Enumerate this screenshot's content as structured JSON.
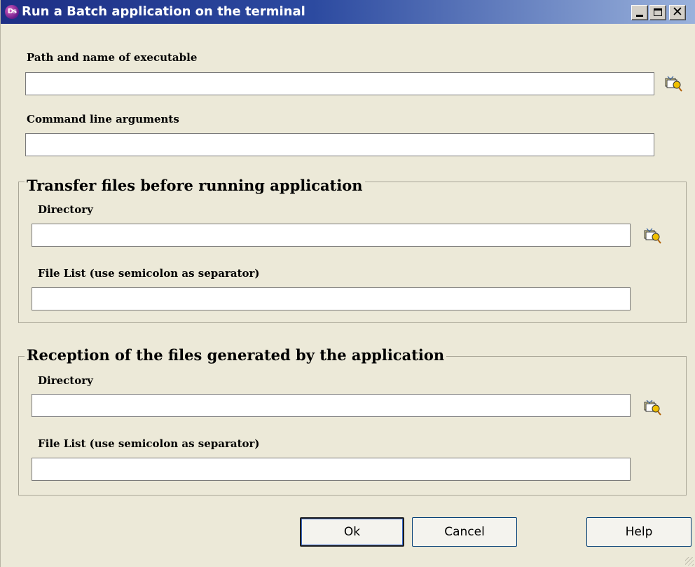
{
  "window": {
    "title": "Run a Batch application on the terminal",
    "app_icon_text": "Ds",
    "controls": {
      "minimize_icon": "minimize-icon",
      "maximize_icon": "maximize-icon",
      "close_symbol": "✕"
    }
  },
  "executable": {
    "label": "Path and name of executable",
    "value": "",
    "browse_icon": "browse-folder-icon"
  },
  "arguments": {
    "label": "Command line arguments",
    "value": ""
  },
  "transfer_group": {
    "legend": "Transfer files before running application",
    "directory_label": "Directory",
    "directory_value": "",
    "file_list_label": "File List (use semicolon as separator)",
    "file_list_value": ""
  },
  "reception_group": {
    "legend": "Reception of the files generated by the application",
    "directory_label": "Directory",
    "directory_value": "",
    "file_list_label": "File List (use semicolon as separator)",
    "file_list_value": ""
  },
  "buttons": {
    "ok": "Ok",
    "cancel": "Cancel",
    "help": "Help"
  },
  "colors": {
    "window_bg": "#ece9d8",
    "titlebar_start": "#1e2f85",
    "titlebar_end": "#9ab2dc",
    "title_text": "#ffffff"
  }
}
